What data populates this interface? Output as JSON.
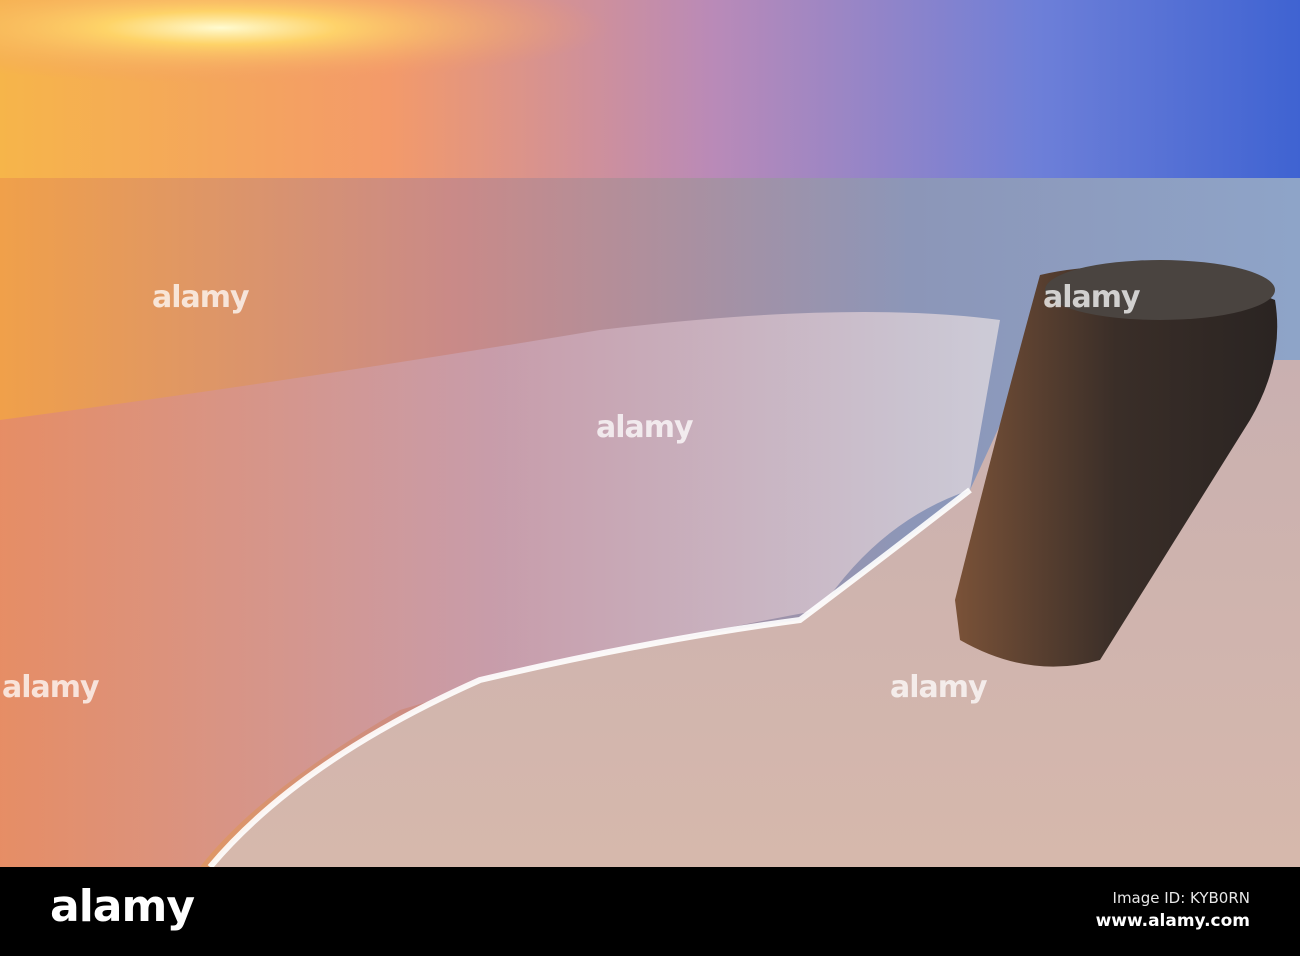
{
  "photo": {
    "subject": "sunset beach with wooden post"
  },
  "watermark": {
    "text": "alamy"
  },
  "footer": {
    "logo": "alamy",
    "image_id": "Image ID: KYB0RN",
    "url": "www.alamy.com"
  }
}
